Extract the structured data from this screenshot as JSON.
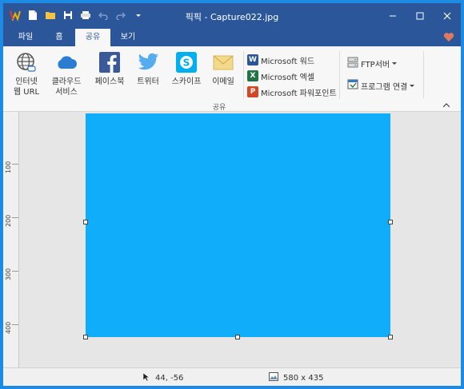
{
  "window": {
    "title": "픽픽 - Capture022.jpg",
    "controls": [
      "minimize",
      "maximize",
      "close"
    ]
  },
  "quick_access": [
    "app-logo-icon",
    "new-icon",
    "open-icon",
    "save-icon",
    "print-icon",
    "undo-icon",
    "redo-icon",
    "customize-icon"
  ],
  "tabs": [
    {
      "label": "파일"
    },
    {
      "label": "홈"
    },
    {
      "label": "공유",
      "active": true
    },
    {
      "label": "보기"
    }
  ],
  "ribbon": {
    "buttons": [
      {
        "label_line1": "인터넷",
        "label_line2": "웹 URL",
        "icon": "globe-icon"
      },
      {
        "label_line1": "클라우드",
        "label_line2": "서비스",
        "icon": "cloud-icon"
      },
      {
        "label_line1": "페이스북",
        "label_line2": "",
        "icon": "facebook-icon"
      },
      {
        "label_line1": "트위터",
        "label_line2": "",
        "icon": "twitter-icon"
      },
      {
        "label_line1": "스카이프",
        "label_line2": "",
        "icon": "skype-icon"
      },
      {
        "label_line1": "이메일",
        "label_line2": "",
        "icon": "email-icon"
      }
    ],
    "microsoft": [
      {
        "label": "Microsoft 워드",
        "letter": "W",
        "color": "#2b579a"
      },
      {
        "label": "Microsoft 엑셀",
        "letter": "X",
        "color": "#217346"
      },
      {
        "label": "Microsoft 파워포인트",
        "letter": "P",
        "color": "#d24726"
      }
    ],
    "right": [
      {
        "label": "FTP서버"
      },
      {
        "label": "프로그램 연결"
      }
    ],
    "group_label": "공유"
  },
  "ruler": {
    "labels": [
      "100",
      "200",
      "300",
      "400"
    ]
  },
  "canvas": {
    "image_color": "#10aefa"
  },
  "status": {
    "coords": "44, -56",
    "size": "580 x 435"
  },
  "colors": {
    "title_bar": "#2b579a",
    "border": "#1d8be4"
  }
}
